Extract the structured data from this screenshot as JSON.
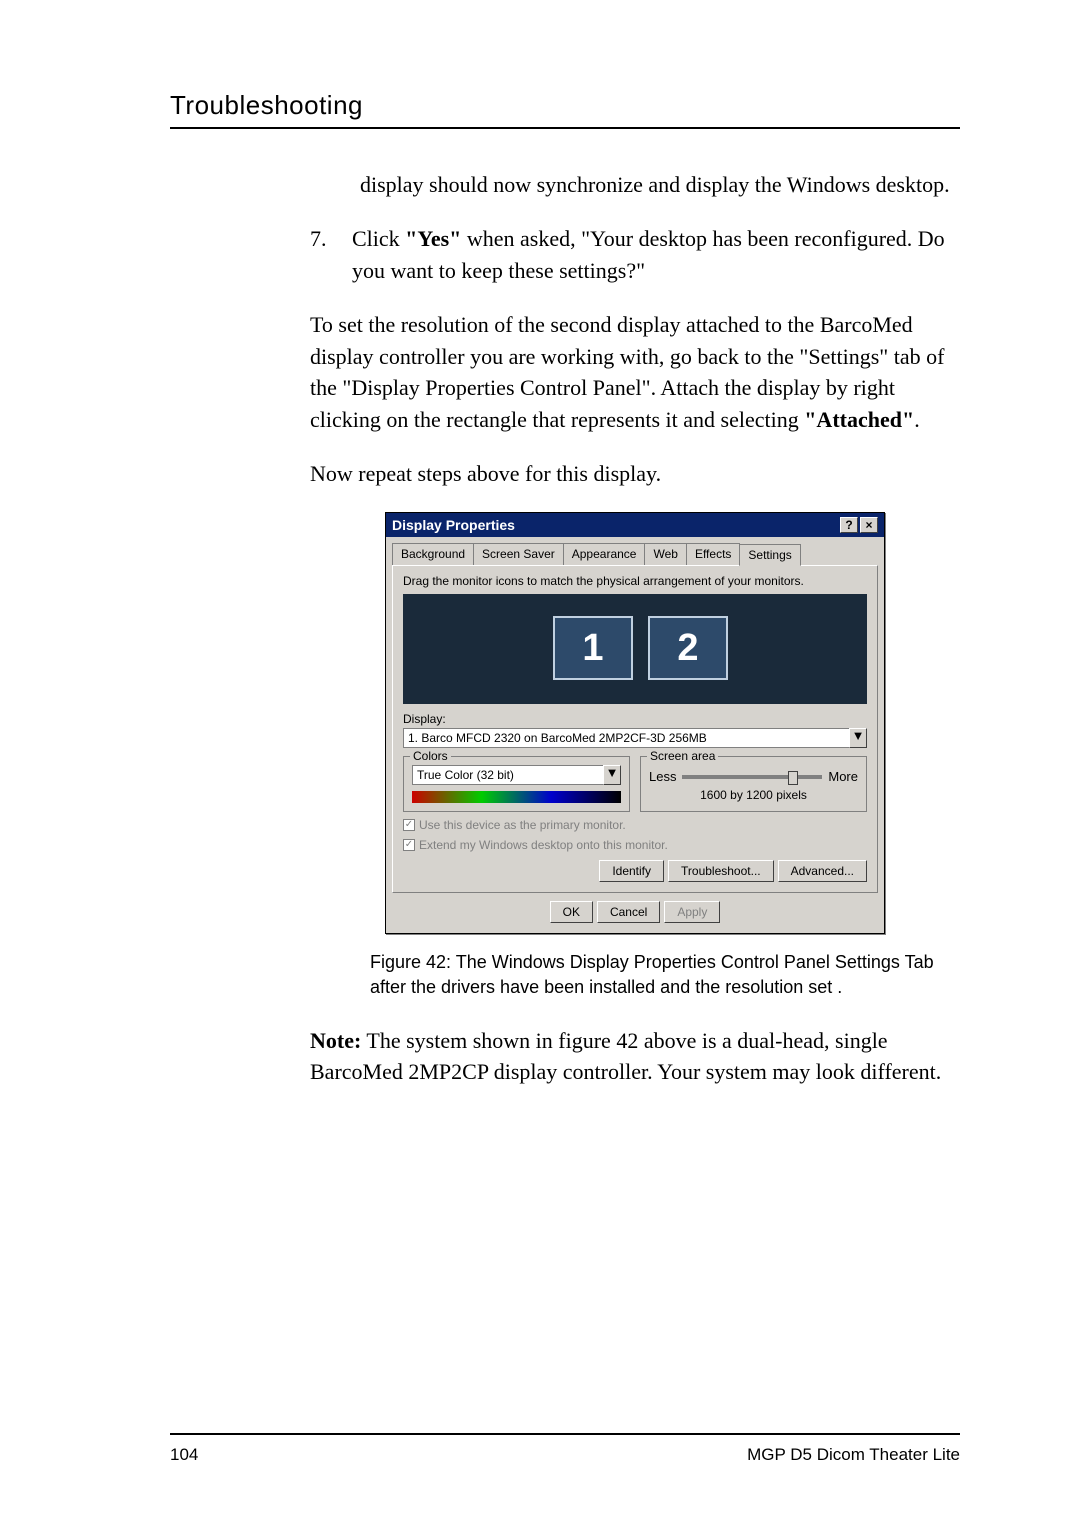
{
  "section_title": "Troubleshooting",
  "text": {
    "p1a": "display should now synchronize and display the Windows desktop.",
    "step7_num": "7.",
    "step7_a": "Click ",
    "step7_b": "\"Yes\"",
    "step7_c": " when asked, \"Your desktop has been reconfigured. Do you want to keep these settings?\"",
    "p2a": "To set the resolution of the second display attached to the BarcoMed display controller you are working with, go back to the \"Settings\" tab of the \"Display Properties Control Panel\". Attach the display by right clicking on the rectangle that represents it and selecting ",
    "p2b": "\"Attached\"",
    "p2c": ".",
    "p3": "Now repeat steps above for this display.",
    "caption": "Figure 42: The Windows Display Properties Control Panel Settings Tab after the drivers have been installed and the resolution set .",
    "note_label": "Note:",
    "note_body": " The system shown in figure 42 above is a dual-head, single BarcoMed 2MP2CP display controller. Your system may look different."
  },
  "dialog": {
    "title": "Display Properties",
    "help_btn": "?",
    "close_btn": "×",
    "tabs": [
      "Background",
      "Screen Saver",
      "Appearance",
      "Web",
      "Effects",
      "Settings"
    ],
    "hint": "Drag the monitor icons to match the physical arrangement of your monitors.",
    "monitor1": "1",
    "monitor2": "2",
    "display_label": "Display:",
    "display_value": "1. Barco MFCD 2320 on BarcoMed 2MP2CF-3D 256MB",
    "colors_legend": "Colors",
    "colors_value": "True Color (32 bit)",
    "screen_legend": "Screen area",
    "less": "Less",
    "more": "More",
    "resolution": "1600 by 1200 pixels",
    "chk1": "Use this device as the primary monitor.",
    "chk2": "Extend my Windows desktop onto this monitor.",
    "identify": "Identify",
    "troubleshoot": "Troubleshoot...",
    "advanced": "Advanced...",
    "ok": "OK",
    "cancel": "Cancel",
    "apply": "Apply",
    "dropdown_glyph": "▼",
    "check_glyph": "✓"
  },
  "footer": {
    "page": "104",
    "doc": "MGP D5 Dicom Theater Lite"
  }
}
